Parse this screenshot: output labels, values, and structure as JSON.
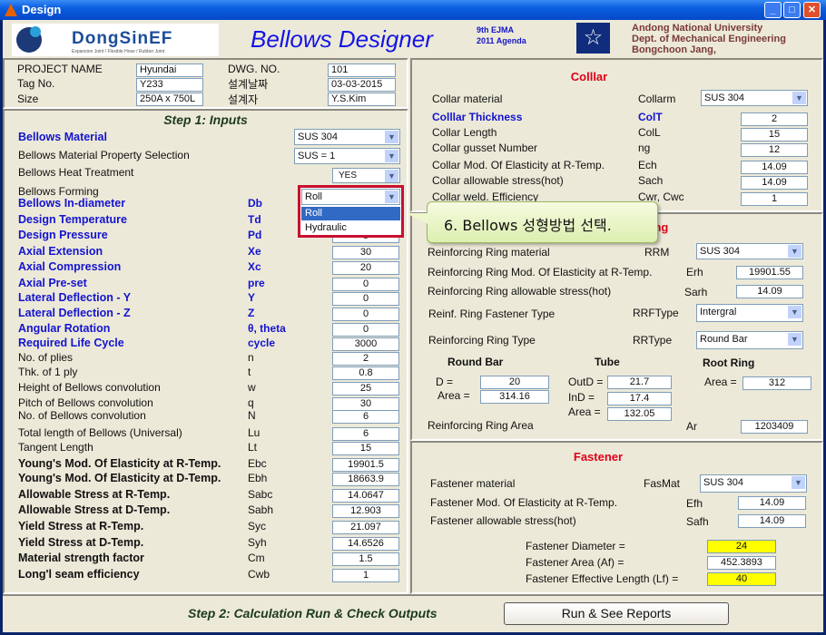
{
  "window": {
    "title": "Design"
  },
  "header": {
    "logo_text": "DongSinEF",
    "logo_tagline": "Expansion Joint / Flexible Hose / Rubber Joint",
    "app_title": "Bellows  Designer",
    "agenda_line1": "9th EJMA",
    "agenda_line2": "2011 Agenda",
    "univ_line1": "Andong National University",
    "univ_line2": "Dept. of Mechanical Engineering",
    "univ_line3": "Bongchoon Jang,"
  },
  "project": {
    "project_name_label": "PROJECT NAME",
    "project_name": "Hyundai",
    "tag_label": "Tag No.",
    "tag": "Y233",
    "size_label": "Size",
    "size": "250A x 750L",
    "dwg_label": "DWG. NO.",
    "dwg": "101",
    "date_label": "설계날짜",
    "date": "03-03-2015",
    "designer_label": "설계자",
    "designer": "Y.S.Kim"
  },
  "step1": {
    "title": "Step 1: Inputs",
    "material": {
      "label": "Bellows  Material",
      "value": "SUS 304"
    },
    "property": {
      "label": "Bellows  Material Property Selection",
      "value": "SUS = 1"
    },
    "heat": {
      "label": "Bellows  Heat Treatment",
      "value": "YES"
    },
    "forming": {
      "label": "Bellows  Forming",
      "value": "Roll",
      "options": [
        "Roll",
        "Hydraulic"
      ]
    },
    "rows": [
      {
        "label": "Bellows  In-diameter",
        "sym": "Db",
        "value": "",
        "style": "blue"
      },
      {
        "label": "Design Temperature",
        "sym": "Td",
        "value": "",
        "style": "blue"
      },
      {
        "label": "Design Pressure",
        "sym": "Pd",
        "value": "5",
        "style": "blue"
      },
      {
        "label": "Axial Extension",
        "sym": "Xe",
        "value": "30",
        "style": "blue"
      },
      {
        "label": "Axial Compression",
        "sym": "Xc",
        "value": "20",
        "style": "blue"
      },
      {
        "label": "Axial Pre-set",
        "sym": "pre",
        "value": "0",
        "style": "blue"
      },
      {
        "label": "Lateral Deflection - Y",
        "sym": "Y",
        "value": "0",
        "style": "blue"
      },
      {
        "label": "Lateral Deflection - Z",
        "sym": "Z",
        "value": "0",
        "style": "blue"
      },
      {
        "label": "Angular Rotation",
        "sym": "θ, theta",
        "value": "0",
        "style": "blue"
      },
      {
        "label": "Required Life Cycle",
        "sym": "cycle",
        "value": "3000",
        "style": "blue"
      },
      {
        "label": "No. of plies",
        "sym": "n",
        "value": "2",
        "style": "plain"
      },
      {
        "label": "Thk. of 1 ply",
        "sym": "t",
        "value": "0.8",
        "style": "plain"
      },
      {
        "label": "Height of Bellows convolution",
        "sym": "w",
        "value": "25",
        "style": "plain"
      },
      {
        "label": "Pitch of Bellows convolution",
        "sym": "q",
        "value": "30",
        "style": "plain"
      },
      {
        "label": "No. of Bellows convolution",
        "sym": "N",
        "value": "6",
        "style": "plain"
      },
      {
        "label": "Total length of Bellows (Universal)",
        "sym": "Lu",
        "value": "6",
        "style": "plain"
      },
      {
        "label": "Tangent Length",
        "sym": "Lt",
        "value": "15",
        "style": "plain"
      },
      {
        "label": "Young's Mod. Of Elasticity at R-Temp.",
        "sym": "Ebc",
        "value": "19901.5",
        "style": "bold"
      },
      {
        "label": "Young's Mod. Of Elasticity at D-Temp.",
        "sym": "Ebh",
        "value": "18663.9",
        "style": "bold"
      },
      {
        "label": "Allowable Stress at R-Temp.",
        "sym": "Sabc",
        "value": "14.0647",
        "style": "bold"
      },
      {
        "label": "Allowable Stress at D-Temp.",
        "sym": "Sabh",
        "value": "12.903",
        "style": "bold"
      },
      {
        "label": "Yield Stress at R-Temp.",
        "sym": "Syc",
        "value": "21.097",
        "style": "bold"
      },
      {
        "label": "Yield Stress at D-Temp.",
        "sym": "Syh",
        "value": "14.6526",
        "style": "bold"
      },
      {
        "label": "Material strength factor",
        "sym": "Cm",
        "value": "1.5",
        "style": "bold"
      },
      {
        "label": "Long'l seam efficiency",
        "sym": "Cwb",
        "value": "1",
        "style": "bold"
      }
    ]
  },
  "collar": {
    "title": "Colllar",
    "material": {
      "label": "Collar  material",
      "sym": "Collarm",
      "value": "SUS 304"
    },
    "rows": [
      {
        "label": "Colllar Thickness",
        "sym": "ColT",
        "value": "2",
        "style": "blue"
      },
      {
        "label": "Collar Length",
        "sym": "ColL",
        "value": "15",
        "style": "plain"
      },
      {
        "label": "Collar gusset Number",
        "sym": "ng",
        "value": "12",
        "style": "plain"
      },
      {
        "label": "Collar Mod. Of Elasticity at R-Temp.",
        "sym": "Ech",
        "value": "14.09",
        "style": "plain"
      },
      {
        "label": "Collar allowable stress(hot)",
        "sym": "Sach",
        "value": "14.09",
        "style": "plain"
      },
      {
        "label": "Collar weld. Efficiency",
        "sym": "Cwr, Cwc",
        "value": "1",
        "style": "plain"
      }
    ]
  },
  "ring": {
    "title": "Reinforcing Ring",
    "material": {
      "label": "Reinforcing Ring  material",
      "sym": "RRM",
      "value": "SUS 304"
    },
    "mod": {
      "label": "Reinforcing Ring Mod. Of Elasticity at R-Temp.",
      "sym": "Erh",
      "value": "19901.55"
    },
    "stress": {
      "label": "Reinforcing Ring allowable stress(hot)",
      "sym": "Sarh",
      "value": "14.09"
    },
    "fastener_type": {
      "label": "Reinf. Ring Fastener  Type",
      "sym": "RRFType",
      "value": "Intergral"
    },
    "type": {
      "label": "Reinforcing Ring  Type",
      "sym": "RRType",
      "value": "Round Bar"
    },
    "round_bar": {
      "title": "Round Bar",
      "d_label": "D =",
      "d": "20",
      "area_label": "Area =",
      "area": "314.16"
    },
    "tube": {
      "title": "Tube",
      "outd_label": "OutD =",
      "outd": "21.7",
      "ind_label": "InD =",
      "ind": "17.4",
      "area_label": "Area =",
      "area": "132.05"
    },
    "root_ring": {
      "title": "Root Ring",
      "area_label": "Area =",
      "area": "312"
    },
    "area": {
      "label": "Reinforcing Ring Area",
      "sym": "Ar",
      "value": "1203409"
    }
  },
  "fastener": {
    "title": "Fastener",
    "material": {
      "label": "Fastener  material",
      "sym": "FasMat",
      "value": "SUS 304"
    },
    "mod": {
      "label": "Fastener Mod. Of Elasticity at R-Temp.",
      "sym": "Efh",
      "value": "14.09"
    },
    "stress": {
      "label": "Fastener allowable stress(hot)",
      "sym": "Safh",
      "value": "14.09"
    },
    "diameter": {
      "label": "Fastener Diameter =",
      "value": "24"
    },
    "area": {
      "label": "Fastener Area (Af) =",
      "value": "452.3893"
    },
    "length": {
      "label": "Fastener Effective Length (Lf) =",
      "value": "40"
    },
    "highlight_color": "#ffff00"
  },
  "step2": {
    "title": "Step 2: Calculation Run & Check Outputs",
    "run_button": "Run & See Reports"
  },
  "callout": {
    "text": "6. Bellows 성형방법 선택."
  }
}
